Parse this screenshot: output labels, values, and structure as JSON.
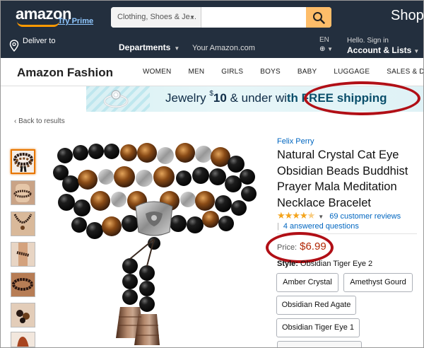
{
  "header": {
    "logo": "amazon",
    "try_prime": "Try Prime",
    "search": {
      "department": "Clothing, Shoes & Je...",
      "placeholder": ""
    },
    "shop_label": "Shop",
    "deliver_to": "Deliver to",
    "departments": "Departments",
    "your_amazon": "Your Amazon.com",
    "language": "EN",
    "hello": "Hello. Sign in",
    "account": "Account & Lists"
  },
  "subnav": {
    "title": "Amazon Fashion",
    "links": [
      "WOMEN",
      "MEN",
      "GIRLS",
      "BOYS",
      "BABY",
      "LUGGAGE",
      "SALES & DEALS"
    ]
  },
  "banner": {
    "prefix": "Jewelry ",
    "currency": "$",
    "amount": "10",
    "middle": " & under wi",
    "highlight": "th FREE shipping"
  },
  "back_link": "‹ Back to results",
  "product": {
    "brand": "Felix Perry",
    "title": "Natural Crystal Cat Eye Obsidian Beads Buddhist Prayer Mala Meditation Necklace Bracelet",
    "rating": 4.5,
    "reviews": "69 customer reviews",
    "answered": "4 answered questions",
    "price_label": "Price:",
    "price": "$6.99",
    "style_label": "Style:",
    "style_value": "Obsidian Tiger Eye 2",
    "options": [
      "Amber Crystal",
      "Amethyst Gourd",
      "Obsidian Red Agate",
      "Obsidian Tiger Eye 1"
    ]
  },
  "colors": {
    "nav_bg": "#232f3e",
    "search_button": "#febd69",
    "price": "#b12704",
    "link": "#0066c0",
    "annotation": "#b10f16"
  }
}
